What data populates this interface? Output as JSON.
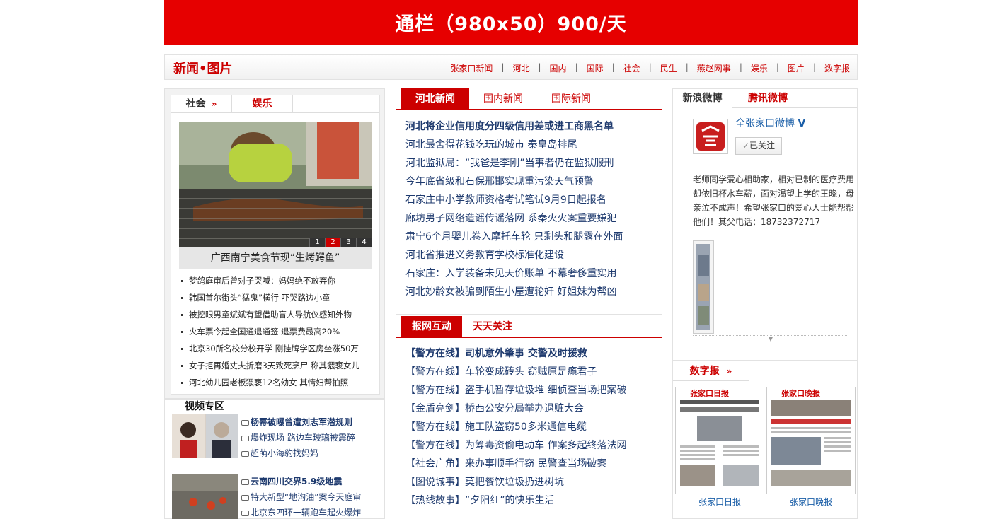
{
  "banner": {
    "text": "通栏（980x50）900/天"
  },
  "header": {
    "title": "新闻•图片",
    "nav": [
      "张家口新闻",
      "河北",
      "国内",
      "国际",
      "社会",
      "民生",
      "燕赵网事",
      "娱乐",
      "图片",
      "数字报"
    ],
    "separator": "|"
  },
  "left": {
    "tabs": [
      {
        "label": "社会"
      },
      {
        "label": "娱乐"
      }
    ],
    "photo": {
      "caption": "广西南宁美食节现“生烤鳄鱼”",
      "pages": [
        "1",
        "2",
        "3",
        "4"
      ],
      "active_page": "2"
    },
    "news": [
      "梦鸽庭审后曾对子哭喊：妈妈绝不放弃你",
      "韩国首尔街头“猛鬼”横行 吓哭路边小童",
      "被挖眼男童斌斌有望借助盲人导航仪感知外物",
      "火车票今起全国通退通签 退票费最高20%",
      "北京30所名校分校开学 刚挂牌学区房坐涨50万",
      "女子拒再婚丈夫折磨3天致死烹尸 称其猥亵女儿",
      "河北幼儿园老板猥亵12名幼女 其情妇帮拍照"
    ]
  },
  "video": {
    "title": "视频专区",
    "group1": [
      "杨幂被曝曾遭刘志军潜规则",
      "爆炸现场 路边车玻璃被震碎",
      "超萌小海豹找妈妈"
    ],
    "group2": [
      "云南四川交界5.9级地震",
      "特大新型“地沟油”案今天庭审",
      "北京东四环一辆跑车起火爆炸"
    ]
  },
  "middle": {
    "tabs1": [
      {
        "label": "河北新闻"
      },
      {
        "label": "国内新闻"
      },
      {
        "label": "国际新闻"
      }
    ],
    "list1": [
      "河北将企业信用度分四级信用差或进工商黑名单",
      "河北最舍得花钱吃玩的城市 秦皇岛排尾",
      "河北监狱局：“我爸是李刚”当事者仍在监狱服刑",
      "今年底省级和石保邢邯实现重污染天气预警",
      "石家庄中小学教师资格考试笔试9月9日起报名",
      "廊坊男子网络造谣传谣落网 系秦火火案重要嫌犯",
      "肃宁6个月婴儿卷入摩托车轮 只剩头和腿露在外面",
      "河北省推进义务教育学校标准化建设",
      "石家庄：入学装备未见天价账单 不幕奢侈重实用",
      "河北妙龄女被骗到陌生小屋遭轮奸 好姐妹为帮凶"
    ],
    "tabs2": [
      {
        "label": "报网互动"
      },
      {
        "label": "天天关注"
      }
    ],
    "list2": [
      "【警方在线】司机意外肇事 交警及时援救",
      "【警方在线】车轮变成砖头 窃贼原是瘾君子",
      "【警方在线】盗手机暂存垃圾堆 细侦查当场把案破",
      "【金盾亮剑】桥西公安分局举办退赃大会",
      "【警方在线】施工队盗窃50多米通信电缆",
      "【警方在线】为筹毒资偷电动车 作案多起终落法网",
      "【社会广角】来办事顺手行窃 民警查当场破案",
      "【图说城事】莫把餐饮垃圾扔进树坑",
      "【热线故事】“夕阳红”的快乐生活"
    ]
  },
  "weibo": {
    "tabs": [
      {
        "label": "新浪微博"
      },
      {
        "label": "腾讯微博"
      }
    ],
    "account": "全张家口微博",
    "follow_label": "已关注",
    "post_text": "老师同学爱心相助家，相对已制的医疗费用却依旧杯水车薪，面对渴望上学的王晓，母亲泣不成声！希望张家口的爱心人士能帮帮他们！其父电话：18732372717"
  },
  "digital": {
    "tab": "数字报",
    "papers": [
      {
        "label": "张家口日报",
        "masthead": "张家口日报"
      },
      {
        "label": "张家口晚报",
        "masthead": "张家口晚报"
      }
    ]
  },
  "colors": {
    "brand_red": "#e60000",
    "link_blue": "#1e3a6e",
    "weibo_blue": "#1b5fa8"
  }
}
